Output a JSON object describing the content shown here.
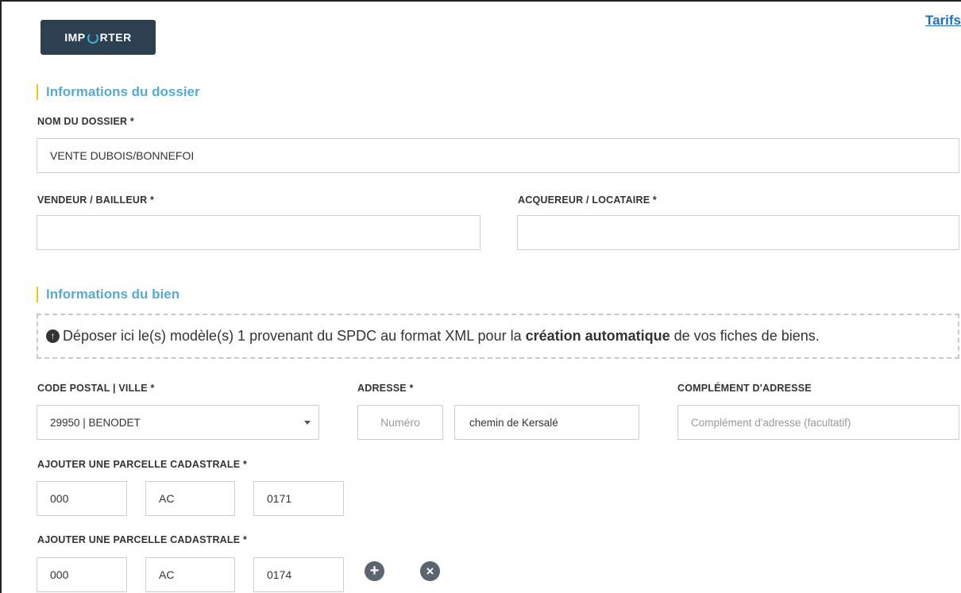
{
  "header": {
    "tarifs_link": "Tarifs",
    "logo_text_left": "IMP",
    "logo_text_right": "RTER"
  },
  "dossier": {
    "section_title": "Informations du dossier",
    "nom_label": "NOM DU DOSSIER *",
    "nom_value": "VENTE DUBOIS/BONNEFOI",
    "vendeur_label": "VENDEUR / BAILLEUR *",
    "vendeur_value": "",
    "acquereur_label": "ACQUEREUR / LOCATAIRE *",
    "acquereur_value": ""
  },
  "bien": {
    "section_title": "Informations du bien",
    "dropzone_text_before": "Déposer ici le(s) modèle(s) 1 provenant du SPDC au format XML pour la ",
    "dropzone_text_bold": "création automatique",
    "dropzone_text_after": " de vos fiches de biens.",
    "cp_label": "CODE POSTAL | VILLE *",
    "cp_value": "29950 | BENODET",
    "adresse_label": "ADRESSE *",
    "numero_placeholder": "Numéro",
    "rue_value": "chemin de Kersalé",
    "complement_label": "COMPLÉMENT D'ADRESSE",
    "complement_placeholder": "Complément d'adresse (facultatif)",
    "parcelles": [
      {
        "label": "AJOUTER UNE PARCELLE CADASTRALE *",
        "prefix": "000",
        "section": "AC",
        "numero": "0171"
      },
      {
        "label": "AJOUTER UNE PARCELLE CADASTRALE *",
        "prefix": "000",
        "section": "AC",
        "numero": "0174"
      }
    ],
    "add_button": "+",
    "remove_button": "×"
  },
  "colors": {
    "accent": "#5aa9cf",
    "marker": "#f0c419",
    "logo_bg": "#2d4052"
  }
}
